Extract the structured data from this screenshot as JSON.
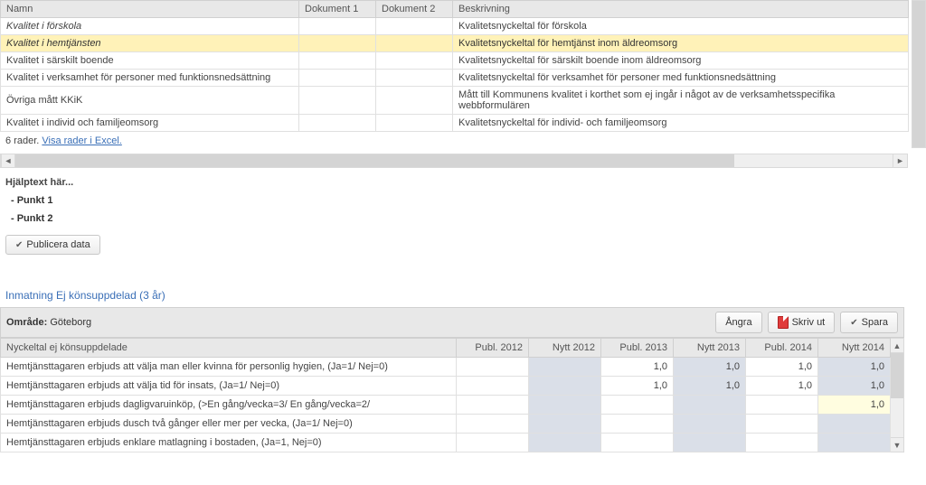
{
  "top_table": {
    "headers": [
      "Namn",
      "Dokument 1",
      "Dokument 2",
      "Beskrivning"
    ],
    "rows": [
      {
        "namn": "Kvalitet i förskola",
        "dok1": "",
        "dok2": "",
        "besk": "Kvalitetsnyckeltal för förskola",
        "italic": true,
        "highlight": false
      },
      {
        "namn": "Kvalitet i hemtjänsten",
        "dok1": "",
        "dok2": "",
        "besk": "Kvalitetsnyckeltal för hemtjänst inom äldreomsorg",
        "italic": true,
        "highlight": true
      },
      {
        "namn": "Kvalitet i särskilt boende",
        "dok1": "",
        "dok2": "",
        "besk": "Kvalitetsnyckeltal för särskilt boende inom äldreomsorg",
        "italic": false,
        "highlight": false
      },
      {
        "namn": "Kvalitet i verksamhet för personer med funktionsnedsättning",
        "dok1": "",
        "dok2": "",
        "besk": "Kvalitetsnyckeltal för verksamhet för personer med funktionsnedsättning",
        "italic": false,
        "highlight": false
      },
      {
        "namn": "Övriga mått KKiK",
        "dok1": "",
        "dok2": "",
        "besk": "Mått till Kommunens kvalitet i korthet som ej ingår i något av de verksamhetsspecifika webbformulären",
        "italic": false,
        "highlight": false
      },
      {
        "namn": "Kvalitet i individ och familjeomsorg",
        "dok1": "",
        "dok2": "",
        "besk": "Kvalitetsnyckeltal för individ- och familjeomsorg",
        "italic": false,
        "highlight": false
      }
    ],
    "footer_count": "6 rader.",
    "footer_link": "Visa rader i Excel."
  },
  "help": {
    "title": "Hjälptext här...",
    "punkt1": "- Punkt 1",
    "punkt2": "- Punkt 2"
  },
  "buttons": {
    "publicera": "Publicera data",
    "angra": "Ångra",
    "skrivut": "Skriv ut",
    "spara": "Spara"
  },
  "section": {
    "title_prefix": "Inmatning Ej könsuppdelad (",
    "years": "3 år",
    "title_suffix": ")",
    "area_label": "Område:",
    "area_value": "Göteborg"
  },
  "data_table": {
    "header_label": "Nyckeltal ej könsuppdelade",
    "cols": [
      "Publ. 2012",
      "Nytt 2012",
      "Publ. 2013",
      "Nytt 2013",
      "Publ. 2014",
      "Nytt 2014"
    ],
    "rows": [
      {
        "label": "Hemtjänsttagaren erbjuds att välja man eller kvinna för personlig hygien, (Ja=1/ Nej=0)",
        "cells": [
          "",
          "",
          "1,0",
          "1,0",
          "1,0",
          "1,0"
        ]
      },
      {
        "label": "Hemtjänsttagaren erbjuds att välja tid för insats, (Ja=1/ Nej=0)",
        "cells": [
          "",
          "",
          "1,0",
          "1,0",
          "1,0",
          "1,0"
        ]
      },
      {
        "label": "Hemtjänsttagaren erbjuds dagligvaruinköp, (>En gång/vecka=3/ En gång/vecka=2/",
        "cells": [
          "",
          "",
          "",
          "",
          "",
          "1,0"
        ],
        "last_highlight": true
      },
      {
        "label": "Hemtjänsttagaren erbjuds dusch två gånger eller mer per vecka, (Ja=1/ Nej=0)",
        "cells": [
          "",
          "",
          "",
          "",
          "",
          ""
        ]
      },
      {
        "label": "Hemtjänsttagaren erbjuds enklare matlagning i bostaden, (Ja=1, Nej=0)",
        "cells": [
          "",
          "",
          "",
          "",
          "",
          ""
        ]
      }
    ]
  }
}
